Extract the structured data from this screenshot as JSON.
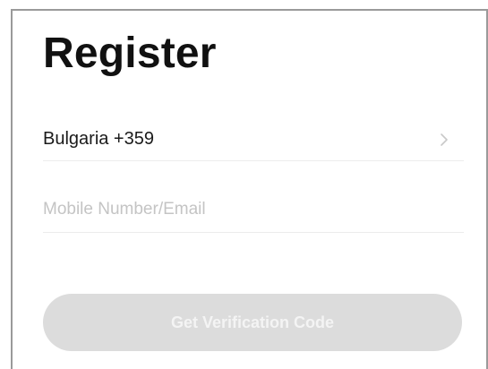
{
  "page": {
    "title": "Register"
  },
  "country_selector": {
    "label": "Bulgaria +359",
    "icon": "chevron-right-icon"
  },
  "mobile_input": {
    "value": "",
    "placeholder": "Mobile Number/Email"
  },
  "verify_button": {
    "label": "Get Verification Code",
    "state": "disabled"
  },
  "colors": {
    "title": "#111111",
    "divider": "#ececec",
    "placeholder": "#c4c4c4",
    "button_bg": "#dcdcdc",
    "button_text": "#f4f4f4",
    "frame": "#9a9a9a"
  }
}
